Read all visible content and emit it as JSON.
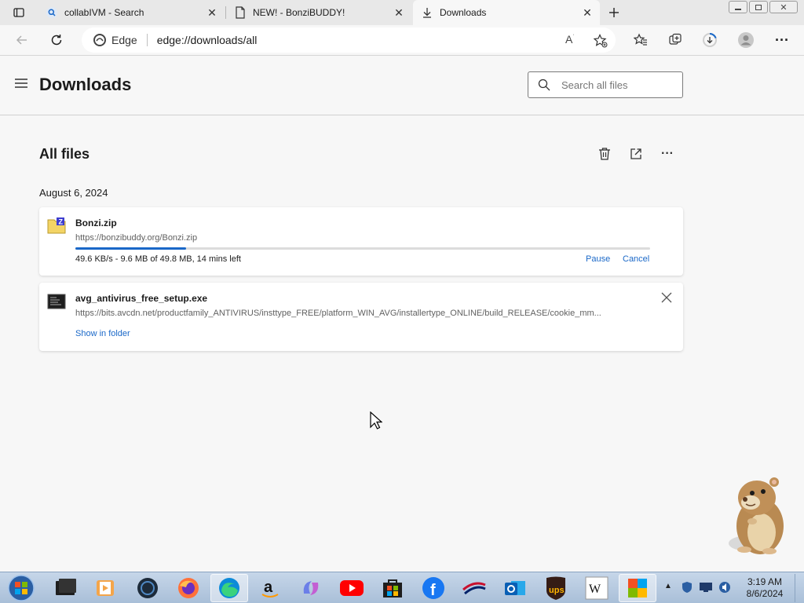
{
  "tabs": [
    {
      "label": "collabIVM - Search",
      "icon": "search-icon"
    },
    {
      "label": "NEW! - BonziBUDDY!",
      "icon": "page-icon"
    },
    {
      "label": "Downloads",
      "icon": "download-icon"
    }
  ],
  "address": {
    "site_label": "Edge",
    "url": "edge://downloads/all"
  },
  "page": {
    "title": "Downloads",
    "search_placeholder": "Search all files"
  },
  "section": {
    "title": "All files",
    "date": "August 6, 2024"
  },
  "downloads": [
    {
      "name": "Bonzi.zip",
      "url": "https://bonzibuddy.org/Bonzi.zip",
      "status": "49.6 KB/s - 9.6 MB of 49.8 MB, 14 mins left",
      "progress": 0.193,
      "actions": [
        "Pause",
        "Cancel"
      ]
    },
    {
      "name": "avg_antivirus_free_setup.exe",
      "url": "https://bits.avcdn.net/productfamily_ANTIVIRUS/insttype_FREE/platform_WIN_AVG/installertype_ONLINE/build_RELEASE/cookie_mm...",
      "action": "Show in folder"
    }
  ],
  "clock": {
    "time": "3:19 AM",
    "date": "8/6/2024"
  },
  "colors": {
    "accent": "#1a68c8",
    "tabstrip": "#e8e8e8",
    "page_bg": "#f7f7f7"
  }
}
